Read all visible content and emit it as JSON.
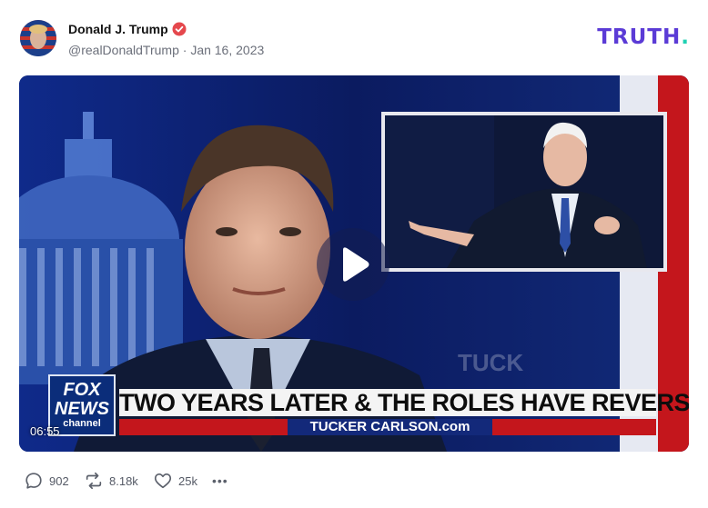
{
  "post": {
    "author_name": "Donald J. Trump",
    "handle": "@realDonaldTrump",
    "separator": "·",
    "date": "Jan 16, 2023",
    "verified_icon": "verified-badge-icon"
  },
  "brand": {
    "logo_text": "TRUTH",
    "logo_dot": ".",
    "accent": "#5b3bd6",
    "dot_color": "#1fd1b3"
  },
  "video": {
    "duration": "06:55",
    "headline": "TWO YEARS LATER & THE ROLES HAVE REVERSED",
    "host_bar": "TUCKER CARLSON.com",
    "network_logo_line1": "FOX",
    "network_logo_line2": "NEWS",
    "network_logo_line3": "channel",
    "play_icon": "play-icon"
  },
  "actions": {
    "reply_count": "902",
    "retruth_count": "8.18k",
    "like_count": "25k",
    "more_label": "•••"
  }
}
